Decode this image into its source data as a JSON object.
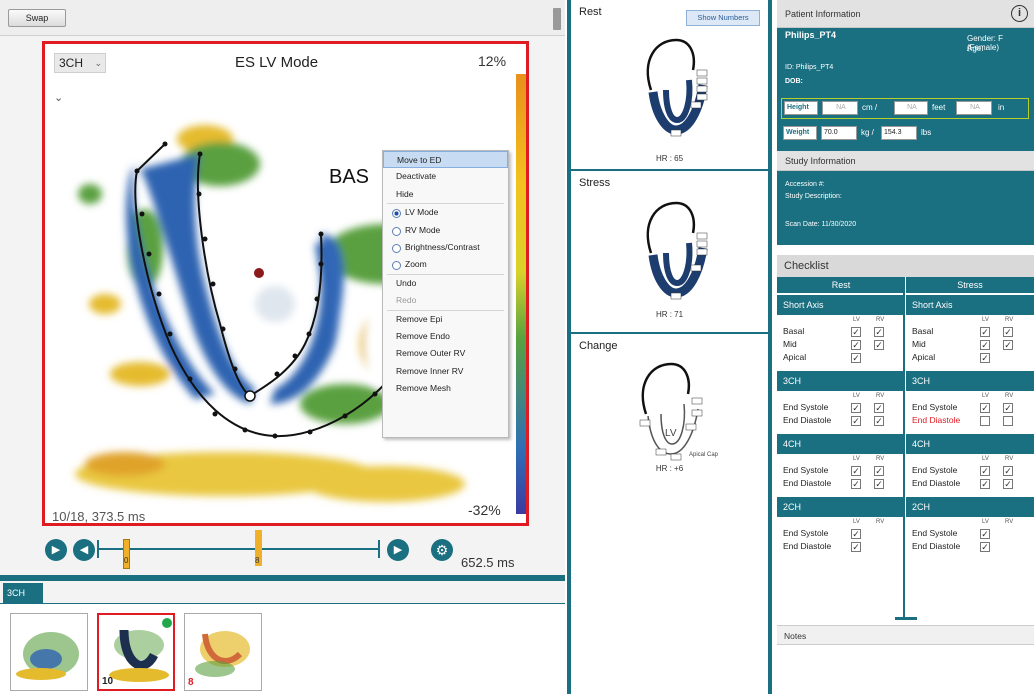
{
  "toolbar": {
    "swap_label": "Swap"
  },
  "viewer": {
    "view_select": "3CH",
    "mode_title": "ES LV Mode",
    "scale_top": "12%",
    "scale_bottom": "-32%",
    "frame_info": "10/18, 373.5 ms",
    "segment_label": "BAS"
  },
  "context_menu": {
    "items": [
      {
        "label": "Move to ED",
        "type": "item",
        "highlighted": true
      },
      {
        "label": "Deactivate",
        "type": "item"
      },
      {
        "label": "Hide",
        "type": "item"
      },
      {
        "type": "separator"
      },
      {
        "label": "LV Mode",
        "type": "radio",
        "checked": true
      },
      {
        "label": "RV Mode",
        "type": "radio"
      },
      {
        "label": "Brightness/Contrast",
        "type": "radio"
      },
      {
        "label": "Zoom",
        "type": "radio"
      },
      {
        "type": "separator"
      },
      {
        "label": "Undo",
        "type": "item"
      },
      {
        "label": "Redo",
        "type": "item",
        "disabled": true
      },
      {
        "type": "separator"
      },
      {
        "label": "Remove Epi",
        "type": "item"
      },
      {
        "label": "Remove Endo",
        "type": "item"
      },
      {
        "label": "Remove Outer RV",
        "type": "item"
      },
      {
        "label": "Remove Inner RV",
        "type": "item"
      },
      {
        "label": "Remove Mesh",
        "type": "item"
      }
    ]
  },
  "playback": {
    "start_marker": "0",
    "current_marker": "8",
    "duration": "652.5 ms"
  },
  "thumbnails": {
    "tab_label": "3CH",
    "items": [
      {
        "number": ""
      },
      {
        "number": "10",
        "selected": true
      },
      {
        "number": "8"
      }
    ]
  },
  "bullseye": {
    "show_numbers_label": "Show Numbers",
    "panels": [
      {
        "title": "Rest",
        "hr": "HR : 65"
      },
      {
        "title": "Stress",
        "hr": "HR : 71"
      },
      {
        "title": "Change",
        "hr": "HR : +6",
        "lv_label": "LV",
        "apical_cap": "Apical Cap"
      }
    ]
  },
  "patient": {
    "header": "Patient Information",
    "name": "Philips_PT4",
    "gender": "Gender: F (Female)",
    "age": "Age:",
    "id": "ID: Philips_PT4",
    "dob": "DOB:",
    "height_label": "Height",
    "height_cm_placeholder": "NA",
    "cm_label": "cm /",
    "height_ft_placeholder": "NA",
    "feet_label": "feet",
    "height_in_placeholder": "NA",
    "in_label": "in",
    "weight_label": "Weight",
    "weight_kg": "70.0",
    "kg_label": "kg /",
    "weight_lbs": "154.3",
    "lbs_label": "lbs"
  },
  "study": {
    "header": "Study Information",
    "accession": "Accession #:",
    "description": "Study Description:",
    "scan_date": "Scan Date: 11/30/2020"
  },
  "checklist": {
    "header": "Checklist",
    "lv": "LV",
    "rv": "RV",
    "columns": [
      {
        "title": "Rest",
        "sections": [
          {
            "title": "Short Axis",
            "rows": [
              {
                "label": "Basal",
                "lv": true,
                "rv": true
              },
              {
                "label": "Mid",
                "lv": true,
                "rv": true
              },
              {
                "label": "Apical",
                "lv": true,
                "rv": null
              }
            ]
          },
          {
            "title": "3CH",
            "rows": [
              {
                "label": "End Systole",
                "lv": true,
                "rv": true
              },
              {
                "label": "End Diastole",
                "lv": true,
                "rv": true
              }
            ]
          },
          {
            "title": "4CH",
            "rows": [
              {
                "label": "End Systole",
                "lv": true,
                "rv": true
              },
              {
                "label": "End Diastole",
                "lv": true,
                "rv": true
              }
            ]
          },
          {
            "title": "2CH",
            "rows": [
              {
                "label": "End Systole",
                "lv": true,
                "rv": null
              },
              {
                "label": "End Diastole",
                "lv": true,
                "rv": null
              }
            ]
          }
        ]
      },
      {
        "title": "Stress",
        "sections": [
          {
            "title": "Short Axis",
            "rows": [
              {
                "label": "Basal",
                "lv": true,
                "rv": true
              },
              {
                "label": "Mid",
                "lv": true,
                "rv": true
              },
              {
                "label": "Apical",
                "lv": true,
                "rv": null
              }
            ]
          },
          {
            "title": "3CH",
            "rows": [
              {
                "label": "End Systole",
                "lv": true,
                "rv": true
              },
              {
                "label": "End Diastole",
                "lv": false,
                "rv": false,
                "warning": true
              }
            ]
          },
          {
            "title": "4CH",
            "rows": [
              {
                "label": "End Systole",
                "lv": true,
                "rv": true
              },
              {
                "label": "End Diastole",
                "lv": true,
                "rv": true
              }
            ]
          },
          {
            "title": "2CH",
            "rows": [
              {
                "label": "End Systole",
                "lv": true,
                "rv": null
              },
              {
                "label": "End Diastole",
                "lv": true,
                "rv": null
              }
            ]
          }
        ]
      }
    ]
  },
  "notes": {
    "header": "Notes"
  },
  "colors": {
    "teal": "#1a6f80",
    "red": "#e01b22",
    "amber": "#f0b02a"
  }
}
